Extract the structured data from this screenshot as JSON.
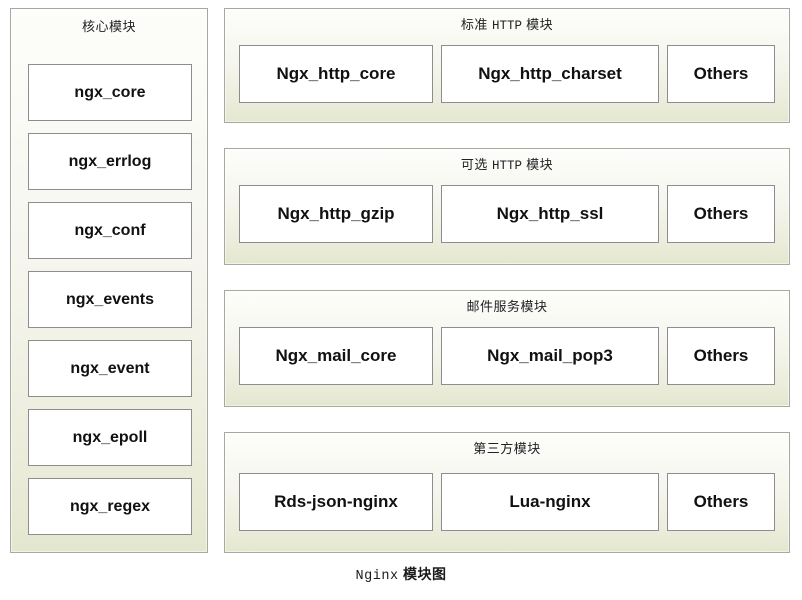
{
  "caption": {
    "latin": "Nginx",
    "cjk": "模块图"
  },
  "core_panel": {
    "title": "核心模块",
    "modules": [
      {
        "label": "ngx_core"
      },
      {
        "label": "ngx_errlog"
      },
      {
        "label": "ngx_conf"
      },
      {
        "label": "ngx_events"
      },
      {
        "label": "ngx_event"
      },
      {
        "label": "ngx_epoll"
      },
      {
        "label": "ngx_regex"
      }
    ]
  },
  "groups": [
    {
      "title_prefix": "标准",
      "title_mono": "HTTP",
      "title_suffix": "模块",
      "modules": [
        {
          "label": "Ngx_http_core"
        },
        {
          "label": "Ngx_http_charset"
        },
        {
          "label": "Others"
        }
      ]
    },
    {
      "title_prefix": "可选",
      "title_mono": "HTTP",
      "title_suffix": "模块",
      "modules": [
        {
          "label": "Ngx_http_gzip"
        },
        {
          "label": "Ngx_http_ssl"
        },
        {
          "label": "Others"
        }
      ]
    },
    {
      "title_prefix": "邮件服务模块",
      "title_mono": "",
      "title_suffix": "",
      "modules": [
        {
          "label": "Ngx_mail_core"
        },
        {
          "label": "Ngx_mail_pop3"
        },
        {
          "label": "Others"
        }
      ]
    },
    {
      "title_prefix": "第三方模块",
      "title_mono": "",
      "title_suffix": "",
      "modules": [
        {
          "label": "Rds-json-nginx"
        },
        {
          "label": "Lua-nginx"
        },
        {
          "label": "Others"
        }
      ]
    }
  ],
  "colors": {
    "panel_border": "#a8a8a0",
    "panel_top": "#fdfdfb",
    "panel_bottom": "#e4e7cf",
    "module_border": "#8d8d8d",
    "module_fill": "#ffffff",
    "text": "#111111",
    "background": "#ffffff"
  }
}
